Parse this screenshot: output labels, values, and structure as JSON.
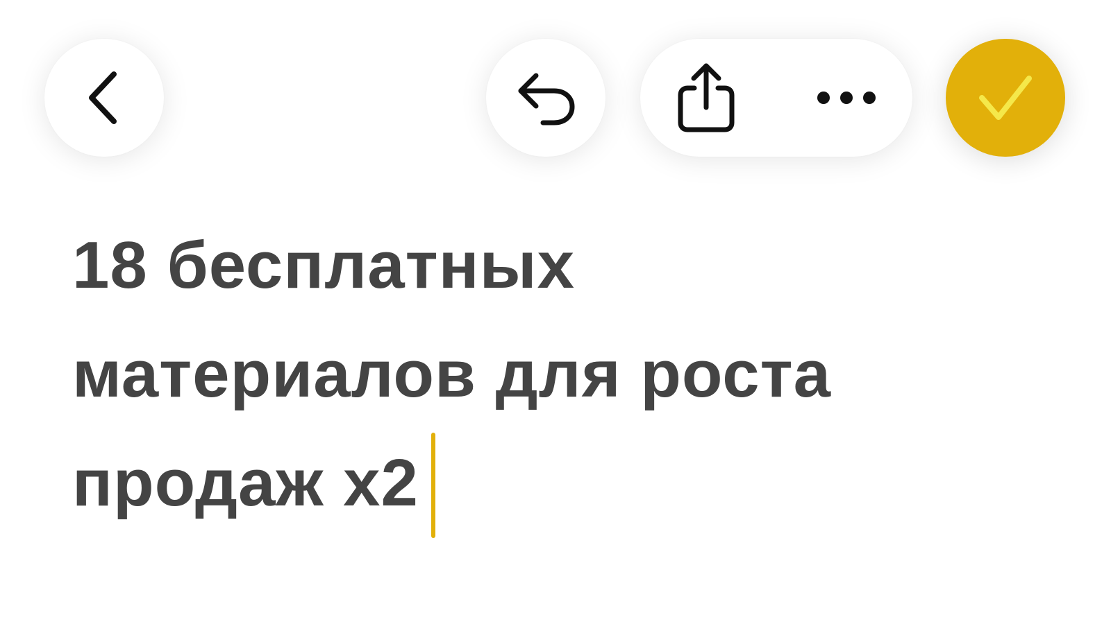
{
  "toolbar": {
    "back_icon": "chevron-left-icon",
    "undo_icon": "undo-icon",
    "share_icon": "share-icon",
    "more_icon": "ellipsis-icon",
    "done_icon": "checkmark-icon"
  },
  "colors": {
    "accent": "#e2b00a",
    "checkmark": "#f5e84a",
    "text": "#444444",
    "background": "#ffffff"
  },
  "note": {
    "title_lines": [
      "18 бесплатных",
      "материалов для роста",
      "продаж х2"
    ]
  }
}
